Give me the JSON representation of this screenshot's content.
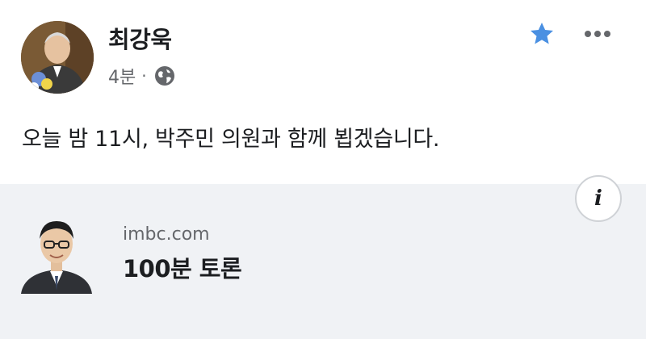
{
  "post": {
    "author_name": "최강욱",
    "timestamp": "4분",
    "separator": "·",
    "audience_icon": "globe-icon",
    "favorite_icon": "star-icon",
    "more_icon": "more-horizontal-icon",
    "text": "오늘 밤 11시, 박주민 의원과 함께 뵙겠습니다.",
    "colors": {
      "star": "#4a90e2",
      "secondary_text": "#65676b",
      "card_bg": "#f0f2f5"
    }
  },
  "link_preview": {
    "info_icon": "info-icon",
    "info_glyph": "i",
    "domain": "imbc.com",
    "title": "100분 토론"
  }
}
